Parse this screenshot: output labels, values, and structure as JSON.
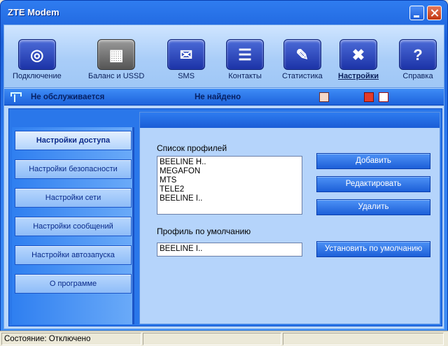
{
  "window": {
    "title": "ZTE Modem"
  },
  "toolbar": {
    "items": [
      {
        "label": "Подключение",
        "icon": "connection-globe-icon"
      },
      {
        "label": "Баланс и USSD",
        "icon": "sim-card-icon"
      },
      {
        "label": "SMS",
        "icon": "envelope-icon"
      },
      {
        "label": "Контакты",
        "icon": "address-book-icon"
      },
      {
        "label": "Статистика",
        "icon": "statistics-document-icon"
      },
      {
        "label": "Настройки",
        "icon": "tools-wrench-icon",
        "active": true
      },
      {
        "label": "Справка",
        "icon": "question-mark-icon"
      }
    ]
  },
  "status_strip": {
    "network": "Не обслуживается",
    "device": "Не найдено"
  },
  "sidebar": {
    "items": [
      {
        "label": "Настройки доступа",
        "active": true
      },
      {
        "label": "Настройки безопасности"
      },
      {
        "label": "Настройки сети"
      },
      {
        "label": "Настройки сообщений"
      },
      {
        "label": "Настройки автозапуска"
      },
      {
        "label": "О программе"
      }
    ]
  },
  "profiles": {
    "list_label": "Список профилей",
    "items": [
      "BEELINE H..",
      "MEGAFON",
      "MTS",
      "TELE2",
      "BEELINE I.."
    ],
    "default_label": "Профиль по умолчанию",
    "default_value": "BEELINE I..",
    "add_button": "Добавить",
    "edit_button": "Редактировать",
    "delete_button": "Удалить",
    "set_default_button": "Установить по умолчанию"
  },
  "statusbar": {
    "state": "Состояние: Отключено"
  },
  "colors": {
    "accent": "#2a77ea",
    "panel": "#b5d4fb",
    "button": "#1d5fd8"
  }
}
